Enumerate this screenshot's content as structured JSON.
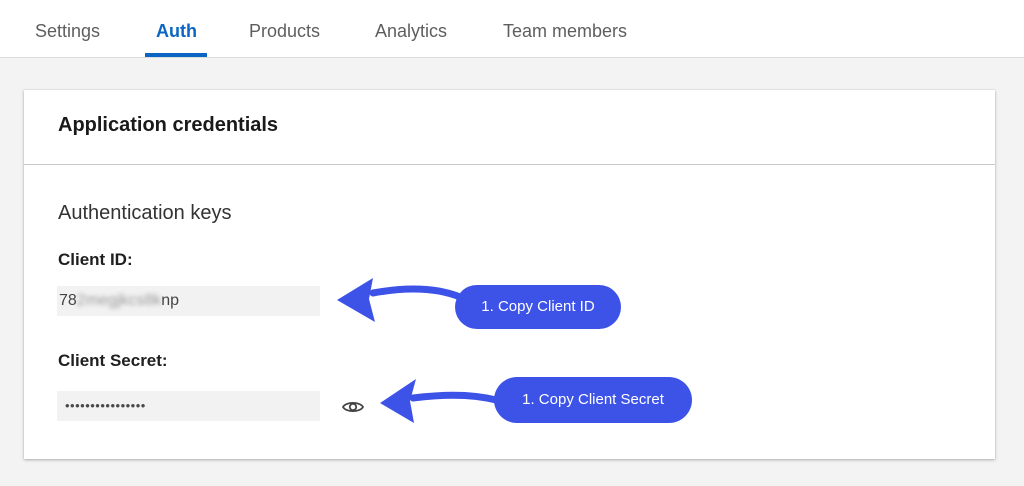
{
  "tabs": [
    {
      "label": "Settings",
      "active": false
    },
    {
      "label": "Auth",
      "active": true
    },
    {
      "label": "Products",
      "active": false
    },
    {
      "label": "Analytics",
      "active": false
    },
    {
      "label": "Team members",
      "active": false
    }
  ],
  "card": {
    "title": "Application credentials",
    "section_title": "Authentication keys",
    "client_id": {
      "label": "Client ID:",
      "value_visible_start": "78",
      "value_blurred": "2megjkcs8k",
      "value_visible_end": "np"
    },
    "client_secret": {
      "label": "Client Secret:",
      "value_masked": "••••••••••••••••",
      "toggle_icon": "eye-icon"
    }
  },
  "annotations": {
    "step_1": "1. Copy Client ID",
    "step_2": "1. Copy Client Secret"
  },
  "colors": {
    "accent": "#0a66c2",
    "annotation": "#3d53e8",
    "page_bg": "#f3f3f3",
    "field_bg": "#f2f2f2"
  }
}
